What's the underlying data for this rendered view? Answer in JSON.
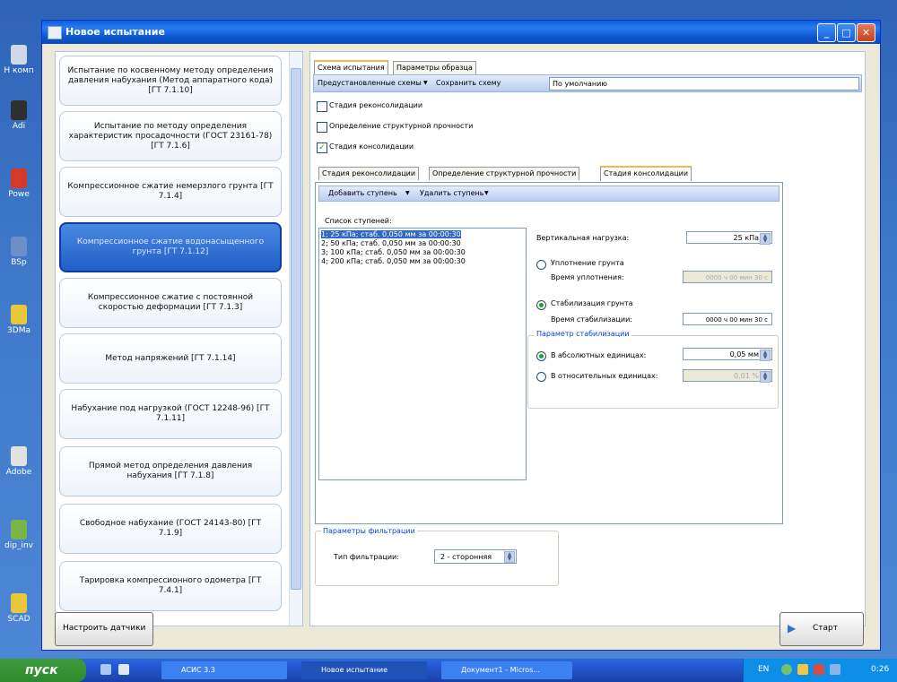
{
  "window": {
    "title": "Новое испытание"
  },
  "desktop_icons": [
    {
      "label": "Н комп"
    },
    {
      "label": "Adi"
    },
    {
      "label": "Powe"
    },
    {
      "label": "BSp"
    },
    {
      "label": "3DMa"
    },
    {
      "label": "Adobe"
    },
    {
      "label": "dip_inv"
    },
    {
      "label": "SCAD"
    }
  ],
  "test_list": [
    {
      "label": "Испытание по косвенному методу определения давления набухания (Метод аппаратного кода) [ГТ 7.1.10]"
    },
    {
      "label": "Испытание по методу определения характеристик просадочности (ГОСТ 23161-78) [ГТ 7.1.6]"
    },
    {
      "label": "Компрессионное сжатие немерзлого грунта [ГТ 7.1.4]"
    },
    {
      "label": "Компрессионное сжатие водонасыщенного грунта [ГТ 7.1.12]"
    },
    {
      "label": "Компрессионное сжатие с постоянной скоростью деформации [ГТ 7.1.3]"
    },
    {
      "label": "Метод напряжений [ГТ 7.1.14]"
    },
    {
      "label": "Набухание под нагрузкой (ГОСТ 12248-96) [ГТ 7.1.11]"
    },
    {
      "label": "Прямой метод определения давления набухания [ГТ 7.1.8]"
    },
    {
      "label": "Свободное набухание (ГОСТ 24143-80) [ГТ 7.1.9]"
    },
    {
      "label": "Тарировка компрессионного одометра [ГТ 7.4.1]"
    }
  ],
  "tabs": {
    "scheme": "Схема испытания",
    "params": "Параметры образца"
  },
  "scheme_bar": {
    "presets": "Предустановленные схемы",
    "save": "Сохранить схему",
    "value": "По умолчанию"
  },
  "stages": {
    "reconsolidation": "Стадия реконсолидации",
    "strength": "Определение структурной прочности",
    "consolidation": "Стадия консолидации"
  },
  "subtabs": {
    "reconsolidation": "Стадия реконсолидации",
    "strength": "Определение структурной прочности",
    "consolidation": "Стадия консолидации"
  },
  "stage_toolbar": {
    "add": "Добавить ступень",
    "remove": "Удалить ступень"
  },
  "steps_label": "Список ступеней:",
  "steps": [
    "1; 25 кПа; стаб. 0,050 мм за 00:00:30",
    "2; 50 кПа; стаб. 0,050 мм за 00:00:30",
    "3; 100 кПа; стаб. 0,050 мм за 00:00:30",
    "4; 200 кПа; стаб. 0,050 мм за 00:00:30"
  ],
  "load": {
    "label": "Вертикальная нагрузка:",
    "value": "25 кПа"
  },
  "compaction": {
    "label": "Уплотнение грунта",
    "time_label": "Время уплотнения:",
    "time_value": "0000 ч 00 мин 30 с"
  },
  "stabilization": {
    "label": "Стабилизация грунта",
    "time_label": "Время стабилизации:",
    "time_value": "0000 ч 00 мин 30 с"
  },
  "stab_param": {
    "title": "Параметр стабилизации",
    "absolute_label": "В абсолютных единицах:",
    "absolute_value": "0,05 мм",
    "relative_label": "В относительных единицах:",
    "relative_value": "0,01 %"
  },
  "filtration": {
    "title": "Параметры фильтрации",
    "type_label": "Тип фильтрации:",
    "type_value": "2 - сторонняя"
  },
  "buttons": {
    "sensors": "Настроить датчики",
    "start": "Старт"
  },
  "taskbar": {
    "start": "пуск",
    "tasks": [
      "АСИС 3.3",
      "Новое испытание",
      "Документ1 - Micros..."
    ],
    "lang": "EN",
    "clock": "0:26"
  }
}
